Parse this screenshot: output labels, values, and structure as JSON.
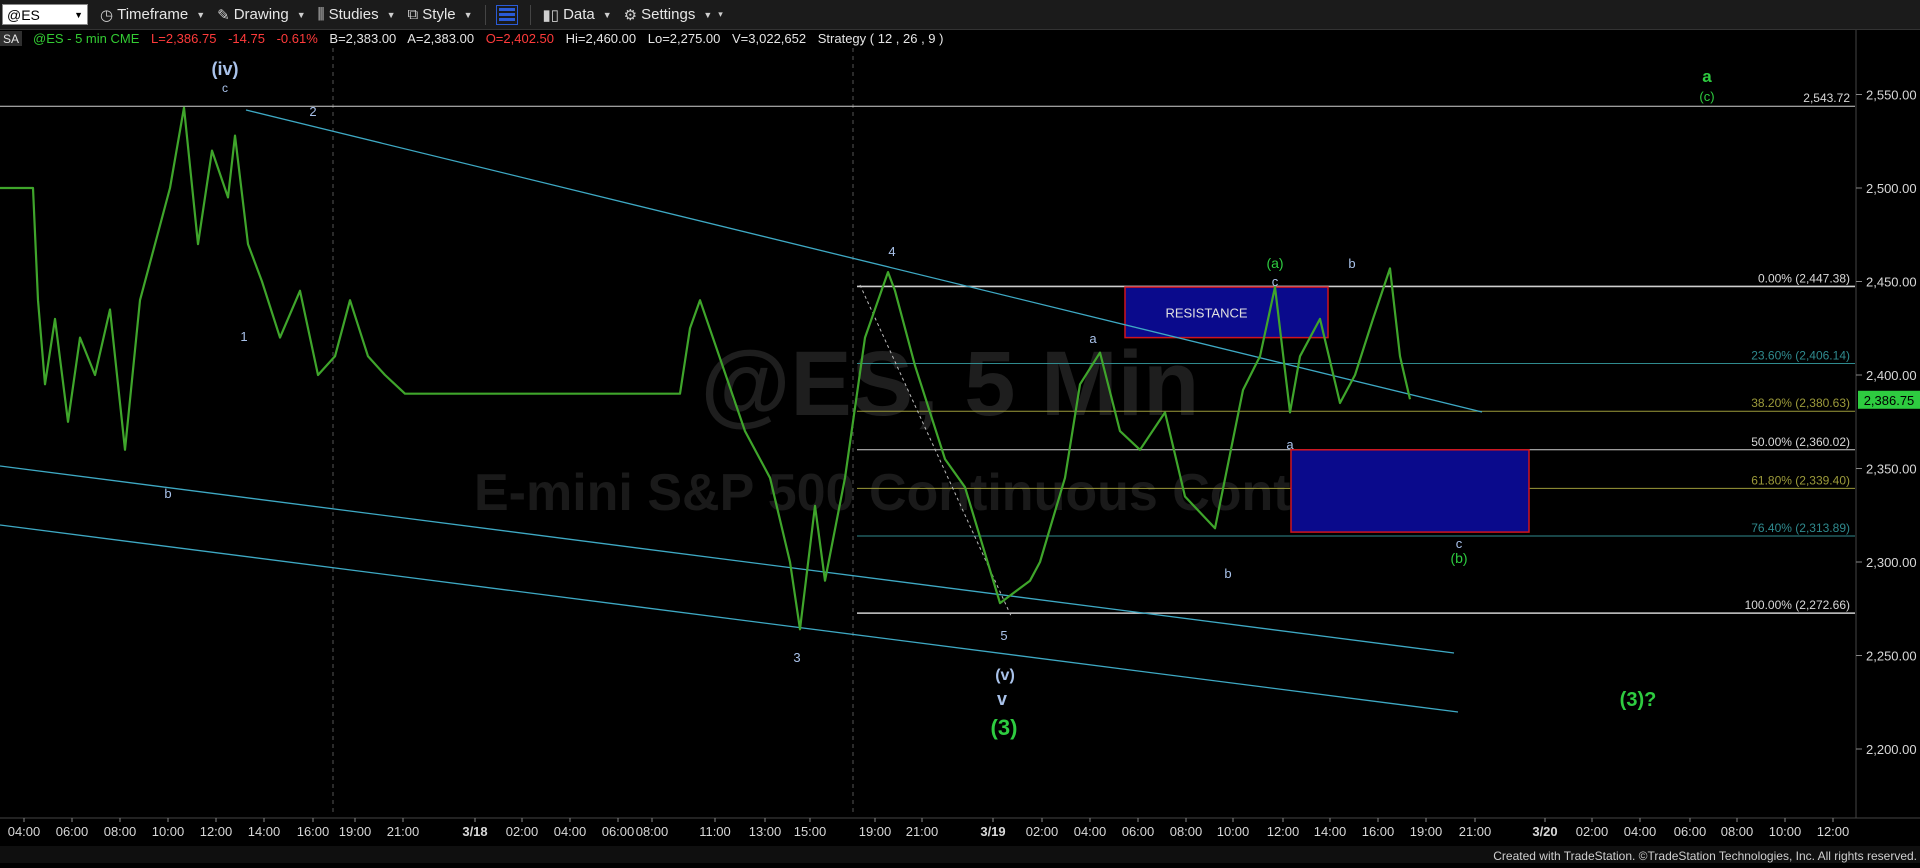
{
  "toolbar": {
    "symbol": "@ES",
    "timeframe": "Timeframe",
    "drawing": "Drawing",
    "studies": "Studies",
    "style": "Style",
    "data": "Data",
    "settings": "Settings"
  },
  "info_bar": {
    "badge": "SA",
    "symbol_info": "@ES - 5 min CME",
    "last": "L=2,386.75",
    "change": "-14.75",
    "change_pct": "-0.61%",
    "bid": "B=2,383.00",
    "ask": "A=2,383.00",
    "open": "O=2,402.50",
    "high": "Hi=2,460.00",
    "low": "Lo=2,275.00",
    "volume": "V=3,022,652",
    "strategy": "Strategy ( 12 , 26 , 9 )"
  },
  "watermark": {
    "line1": "@ES, 5 Min",
    "line2": "E-mini S&P 500 Continuous Contract"
  },
  "footer": "Created with TradeStation. ©TradeStation Technologies, Inc. All rights reserved.",
  "colors": {
    "price": "#3fa52b",
    "trendline": "#3ea9c4",
    "fib_white": "#cfcfcf",
    "fib_teal": "#2f8a8e",
    "fib_olive": "#9c9a3a",
    "resistance_box": "#0a0a8c",
    "box_border": "#d0141e",
    "wave_green": "#2ecc40",
    "wave_blue": "#a9c2ea",
    "price_tag": "#2ecc40"
  },
  "chart_data": {
    "type": "line",
    "title": "",
    "xlabel": "",
    "ylabel": "",
    "ylim": [
      2170,
      2580
    ],
    "x_ticks": [
      "04:00",
      "06:00",
      "08:00",
      "10:00",
      "12:00",
      "14:00",
      "16:00",
      "19:00",
      "21:00",
      "3/18",
      "02:00",
      "04:00",
      "06:00",
      "08:00",
      "11:00",
      "13:00",
      "15:00",
      "19:00",
      "21:00",
      "3/19",
      "02:00",
      "04:00",
      "06:00",
      "08:00",
      "10:00",
      "12:00",
      "14:00",
      "16:00",
      "19:00",
      "21:00",
      "3/20",
      "02:00",
      "04:00",
      "06:00",
      "08:00",
      "10:00",
      "12:00"
    ],
    "y_ticks": [
      "2,550.00",
      "2,500.00",
      "2,450.00",
      "2,400.00",
      "2,350.00",
      "2,300.00",
      "2,250.00",
      "2,200.00"
    ],
    "y_tick_values": [
      2550,
      2500,
      2450,
      2400,
      2350,
      2300,
      2250,
      2200
    ],
    "last_price": {
      "label": "2,386.75",
      "value": 2386.75
    },
    "series": [
      {
        "values": [
          2500,
          2500,
          2440,
          2395,
          2430,
          2375,
          2420,
          2400,
          2435,
          2360,
          2440,
          2470,
          2500,
          2543,
          2470,
          2520,
          2495,
          2528,
          2470,
          2450,
          2420,
          2445,
          2400,
          2410,
          2440,
          2410,
          2400,
          2390,
          2390,
          2390,
          2390,
          2390,
          2425,
          2440,
          2370,
          2345,
          2300,
          2264,
          2330,
          2290,
          2345,
          2420,
          2455,
          2445,
          2405,
          2355,
          2340,
          2278,
          2290,
          2300,
          2345,
          2395,
          2412,
          2370,
          2360,
          2380,
          2335,
          2318,
          2392,
          2410,
          2447,
          2380,
          2410,
          2430,
          2385,
          2400,
          2430,
          2457,
          2410,
          2387
        ]
      }
    ],
    "horizontal_lines": [
      {
        "label": "2,543.72",
        "value": 2543.72
      },
      {
        "label": "0.00% (2,447.38)",
        "value": 2447.38
      },
      {
        "label": "23.60% (2,406.14)",
        "value": 2406.14
      },
      {
        "label": "38.20% (2,380.63)",
        "value": 2380.63
      },
      {
        "label": "50.00% (2,360.02)",
        "value": 2360.02
      },
      {
        "label": "61.80% (2,339.40)",
        "value": 2339.4
      },
      {
        "label": "76.40% (2,313.89)",
        "value": 2313.89
      },
      {
        "label": "100.00% (2,272.66)",
        "value": 2272.66
      }
    ],
    "zones": [
      {
        "label": "RESISTANCE",
        "top": 2447,
        "bottom": 2420
      },
      {
        "label": "",
        "top": 2360,
        "bottom": 2316
      }
    ],
    "wave_labels": [
      {
        "text": "(iv)",
        "color": "blue"
      },
      {
        "text": "c",
        "color": "blue"
      },
      {
        "text": "2",
        "color": "blue"
      },
      {
        "text": "1",
        "color": "blue"
      },
      {
        "text": "b",
        "color": "blue"
      },
      {
        "text": "3",
        "color": "blue"
      },
      {
        "text": "4",
        "color": "blue"
      },
      {
        "text": "5",
        "color": "blue"
      },
      {
        "text": "(v)",
        "color": "blue"
      },
      {
        "text": "v",
        "color": "blue"
      },
      {
        "text": "(3)",
        "color": "green"
      },
      {
        "text": "a",
        "color": "blue"
      },
      {
        "text": "b",
        "color": "blue"
      },
      {
        "text": "(a)",
        "color": "green"
      },
      {
        "text": "c",
        "color": "blue"
      },
      {
        "text": "a",
        "color": "blue"
      },
      {
        "text": "b",
        "color": "blue"
      },
      {
        "text": "c",
        "color": "blue"
      },
      {
        "text": "(b)",
        "color": "green"
      },
      {
        "text": "a",
        "color": "green"
      },
      {
        "text": "(c)",
        "color": "green"
      },
      {
        "text": "(3)?",
        "color": "green"
      }
    ]
  }
}
